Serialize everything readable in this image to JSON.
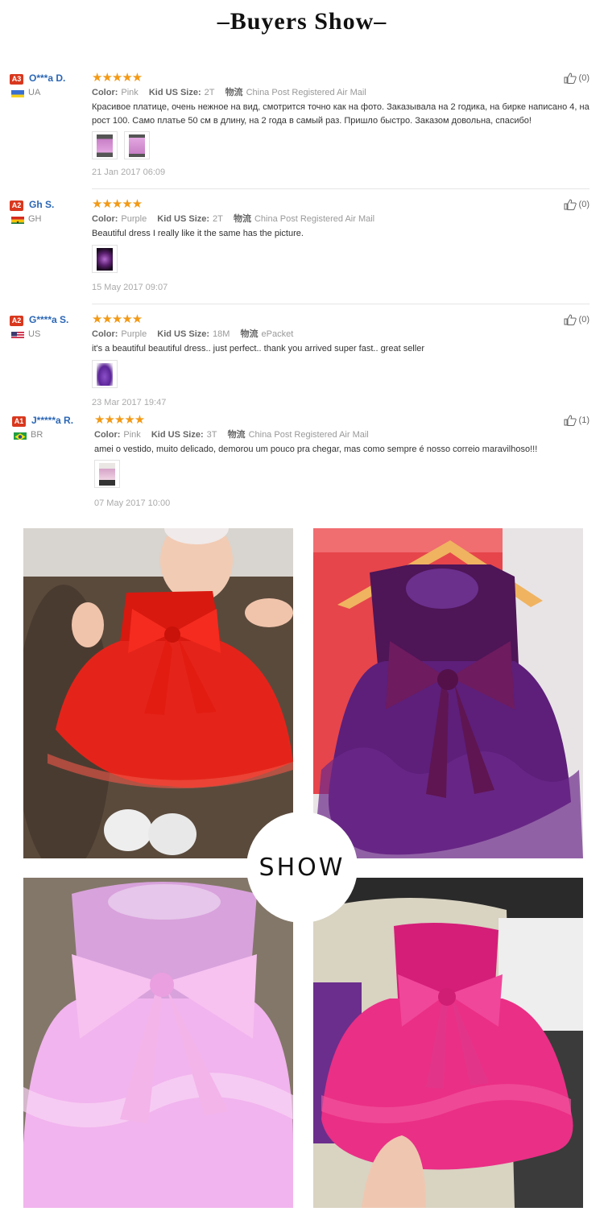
{
  "page": {
    "title": "–Buyers Show–",
    "badge": "SHOW"
  },
  "labels": {
    "color": "Color:",
    "size": "Kid US Size:",
    "logistics": "物流"
  },
  "colors": {
    "accent_user": "#2a66b5",
    "stars": "#f29a17",
    "level_badge": "#d9381e"
  },
  "reviews": [
    {
      "level": "A3",
      "user": "O***a D.",
      "country": "UA",
      "flag_icon": "ukraine-flag-icon",
      "stars": "★★★★★",
      "rating": 5,
      "color": "Pink",
      "size": "2T",
      "shipping": "China Post Registered Air Mail",
      "text": "Красивое платице, очень нежное на вид, смотрится точно как на фото. Заказывала на 2 годика, на бирке написано 4, на рост 100. Само платье 50 см в длину, на 2 года в самый раз. Пришло быстро. Заказом довольна, спасибо!",
      "date": "21 Jan 2017 06:09",
      "likes": "(0)",
      "thumb_colors": [
        "#c87fc6",
        "#c87fc6"
      ]
    },
    {
      "level": "A2",
      "user": "Gh S.",
      "country": "GH",
      "flag_icon": "ghana-flag-icon",
      "stars": "★★★★★",
      "rating": 5,
      "color": "Purple",
      "size": "2T",
      "shipping": "China Post Registered Air Mail",
      "text": "Beautiful dress I really like it the same has the picture.",
      "date": "15 May 2017 09:07",
      "likes": "(0)",
      "thumb_colors": [
        "#5a1f6e"
      ]
    },
    {
      "level": "A2",
      "user": "G****a S.",
      "country": "US",
      "flag_icon": "usa-flag-icon",
      "stars": "★★★★★",
      "rating": 5,
      "color": "Purple",
      "size": "18M",
      "shipping": "ePacket",
      "text": "it's a beautiful beautiful dress.. just perfect.. thank you arrived super fast.. great seller",
      "date": "23 Mar 2017 19:47",
      "likes": "(0)",
      "thumb_colors": [
        "#6a2aa0"
      ]
    },
    {
      "level": "A1",
      "user": "J*****a R.",
      "country": "BR",
      "flag_icon": "brazil-flag-icon",
      "stars": "★★★★★",
      "rating": 5,
      "color": "Pink",
      "size": "3T",
      "shipping": "China Post Registered Air Mail",
      "text": "amei o vestido, muito delicado, demorou um pouco pra chegar, mas como sempre é nosso correio maravilhoso!!!",
      "date": "07 May 2017 10:00",
      "likes": "(1)",
      "thumb_colors": [
        "#d6a3c8"
      ]
    }
  ],
  "photos": [
    {
      "name": "red-dress-photo",
      "dress": "#e01a12",
      "bg": "#5a4a3c"
    },
    {
      "name": "purple-dress-photo",
      "dress": "#5b1a6b",
      "bg": "#e8e4e6"
    },
    {
      "name": "pink-dress-photo",
      "dress": "#f1b4ee",
      "bg": "#7b6f63"
    },
    {
      "name": "rose-dress-photo",
      "dress": "#ea2f86",
      "bg": "#3b3b3b"
    }
  ]
}
